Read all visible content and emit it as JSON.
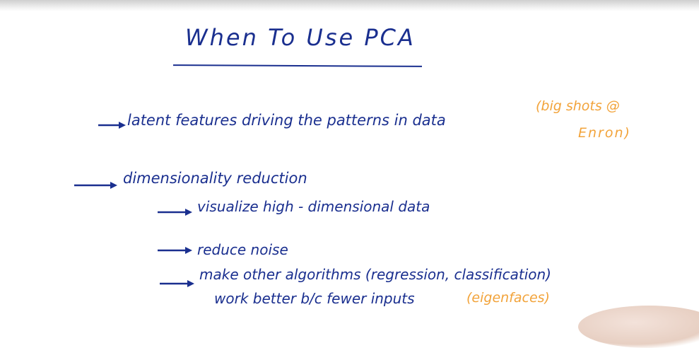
{
  "title": "When To Use PCA",
  "bullets": {
    "latent": "latent features driving the patterns in data",
    "latent_note_line1": "(big shots @",
    "latent_note_line2": "Enron)",
    "dimred": "dimensionality reduction",
    "sub_visualize": "visualize high - dimensional data",
    "sub_noise": "reduce noise",
    "sub_algorithms_line1": "make other algorithms (regression, classification)",
    "sub_algorithms_line2": "work better b/c fewer inputs",
    "sub_algorithms_note": "(eigenfaces)"
  },
  "colors": {
    "ink": "#1a2f8f",
    "note": "#f2a33a"
  }
}
